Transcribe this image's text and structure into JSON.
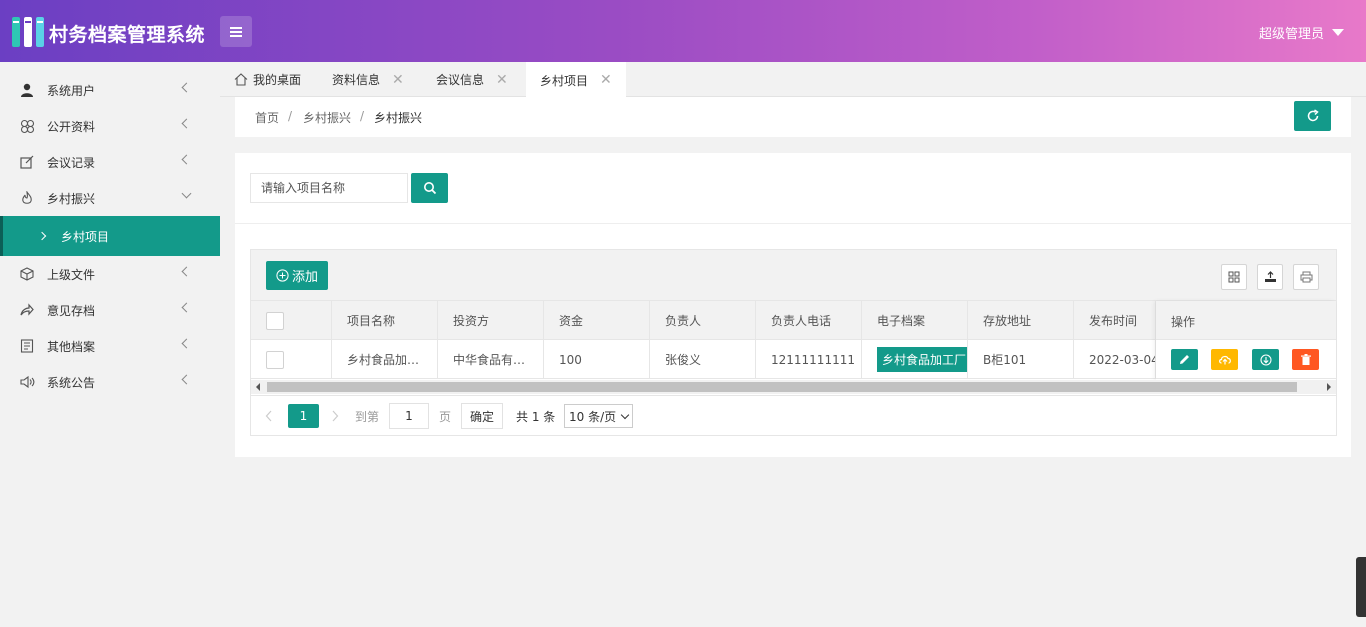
{
  "header": {
    "app_title": "村务档案管理系统",
    "user_name": "超级管理员"
  },
  "sidebar": {
    "items": [
      {
        "label": "系统用户",
        "icon": "user-icon"
      },
      {
        "label": "公开资料",
        "icon": "clover-icon"
      },
      {
        "label": "会议记录",
        "icon": "edit-icon"
      },
      {
        "label": "乡村振兴",
        "icon": "fire-icon",
        "expanded": true
      },
      {
        "label": "上级文件",
        "icon": "cube-icon"
      },
      {
        "label": "意见存档",
        "icon": "share-icon"
      },
      {
        "label": "其他档案",
        "icon": "list-icon"
      },
      {
        "label": "系统公告",
        "icon": "speaker-icon"
      }
    ],
    "sub_item": {
      "label": "乡村项目",
      "parent": "乡村振兴",
      "active": true
    }
  },
  "tabs": [
    {
      "label": "我的桌面",
      "icon": "home-icon",
      "closable": false
    },
    {
      "label": "资料信息",
      "closable": true
    },
    {
      "label": "会议信息",
      "closable": true
    },
    {
      "label": "乡村项目",
      "closable": true,
      "active": true
    }
  ],
  "breadcrumb": {
    "items": [
      "首页",
      "乡村振兴",
      "乡村振兴"
    ],
    "separator": "/"
  },
  "search": {
    "placeholder": "请输入项目名称"
  },
  "toolbar": {
    "add_label": "添加"
  },
  "table": {
    "columns": [
      "项目名称",
      "投资方",
      "资金",
      "负责人",
      "负责人电话",
      "电子档案",
      "存放地址",
      "发布时间",
      "操作"
    ],
    "rows": [
      {
        "name": "乡村食品加…",
        "investor": "中华食品有…",
        "fund": "100",
        "owner": "张俊义",
        "phone": "12111111111",
        "file": "乡村食品加工厂",
        "location": "B柜101",
        "published": "2022-03-04."
      }
    ]
  },
  "pager": {
    "current_page": "1",
    "goto_label": "到第",
    "goto_value": "1",
    "page_suffix": "页",
    "confirm_label": "确定",
    "total_label": "共 1 条",
    "page_size": "10 条/页"
  },
  "colors": {
    "primary": "#139a8a",
    "warn": "#ffb800",
    "danger": "#ff5722",
    "header_start": "#6b3fc3",
    "header_end": "#e879c9"
  }
}
